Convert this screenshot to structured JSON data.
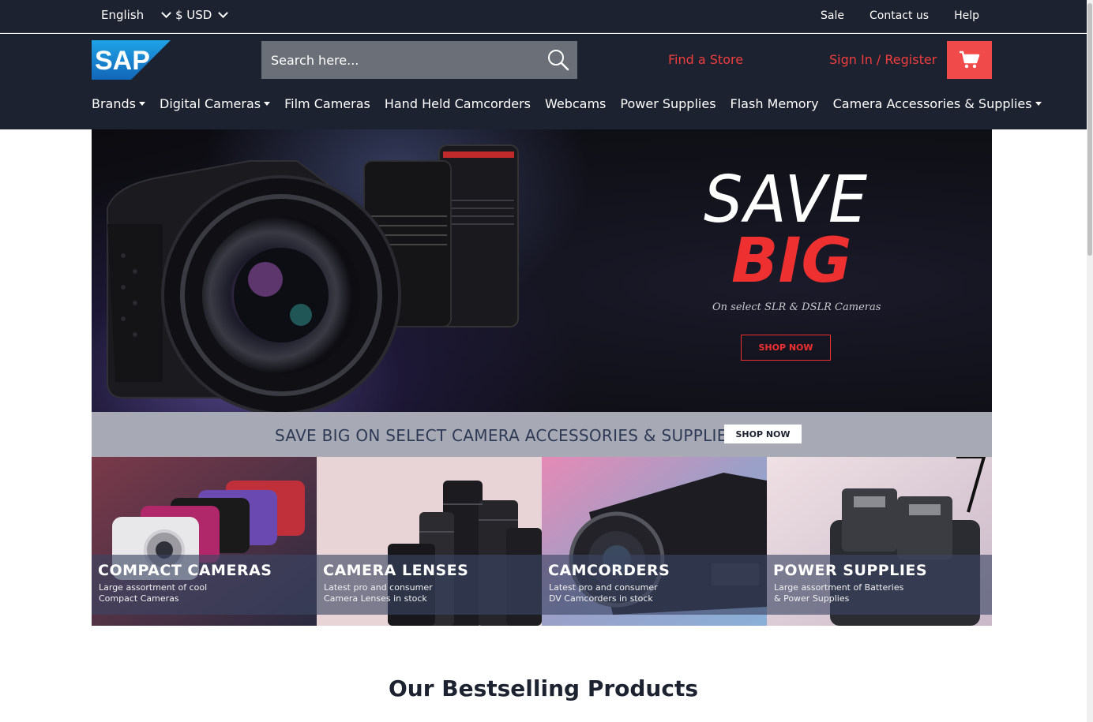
{
  "topbar": {
    "language": "English",
    "currency": "$ USD",
    "links": [
      "Sale",
      "Contact us",
      "Help"
    ]
  },
  "header": {
    "logo_text": "SAP",
    "search_placeholder": "Search here...",
    "find_store": "Find a Store",
    "sign_in": "Sign In / Register"
  },
  "nav": [
    {
      "label": "Brands",
      "dropdown": true
    },
    {
      "label": "Digital Cameras",
      "dropdown": true
    },
    {
      "label": "Film Cameras",
      "dropdown": false
    },
    {
      "label": "Hand Held Camcorders",
      "dropdown": false
    },
    {
      "label": "Webcams",
      "dropdown": false
    },
    {
      "label": "Power Supplies",
      "dropdown": false
    },
    {
      "label": "Flash Memory",
      "dropdown": false
    },
    {
      "label": "Camera Accessories & Supplies",
      "dropdown": true
    }
  ],
  "hero": {
    "line1": "SAVE",
    "line2": "BIG",
    "subtitle": "On select SLR & DSLR Cameras",
    "button": "SHOP NOW"
  },
  "strip": {
    "text": "SAVE BIG ON SELECT CAMERA ACCESSORIES & SUPPLIES",
    "button": "SHOP NOW"
  },
  "categories": [
    {
      "title": "COMPACT CAMERAS",
      "desc1": "Large assortment of cool",
      "desc2": "Compact Cameras"
    },
    {
      "title": "CAMERA LENSES",
      "desc1": "Latest pro and consumer",
      "desc2": "Camera Lenses in stock"
    },
    {
      "title": "CAMCORDERS",
      "desc1": "Latest pro and consumer",
      "desc2": "DV Camcorders in stock"
    },
    {
      "title": "POWER SUPPLIES",
      "desc1": "Large assortment of Batteries",
      "desc2": "& Power Supplies"
    }
  ],
  "section_title": "Our Bestselling Products",
  "colors": {
    "header_bg": "#1d2230",
    "accent_red": "#ef3d3d",
    "strip_bg": "#a7aab4"
  }
}
